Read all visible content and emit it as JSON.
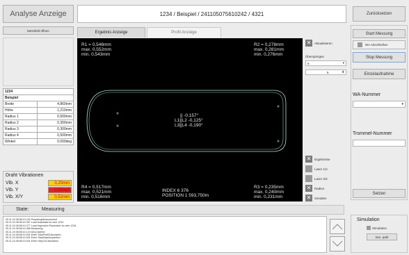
{
  "app": {
    "title": "Analyse Anzeige"
  },
  "header": {
    "path": "1234 / Beispiel / 241105075610242 / 4321",
    "back_label": "Zurücksetzen"
  },
  "left": {
    "open_list_button": "Messfeld öffnen",
    "table": {
      "heading1": "1234",
      "heading2": "Beispiel",
      "rows": [
        {
          "label": "Breite",
          "value": "4,860mm"
        },
        {
          "label": "Höhe",
          "value": "1,210mm"
        },
        {
          "label": "Radius 1",
          "value": "0,500mm"
        },
        {
          "label": "Radius 2",
          "value": "0,300mm"
        },
        {
          "label": "Radius 3",
          "value": "0,300mm"
        },
        {
          "label": "Radius 4",
          "value": "0,500mm"
        },
        {
          "label": "Winkel",
          "value": "0,000deg"
        }
      ]
    },
    "vibration": {
      "title": "Draht Vibrationen",
      "rows": [
        {
          "label": "Vib. X",
          "value": "0,20mm",
          "color": "#ffd000"
        },
        {
          "label": "Vib. Y",
          "value": "0,65mm",
          "color": "#e82020"
        },
        {
          "label": "Vib. X/Y",
          "value": "0,52mm",
          "color": "#ffd000"
        }
      ]
    }
  },
  "tabs": [
    {
      "label": "Ergebnis Anzeige"
    },
    {
      "label": "Profil Anzeige"
    }
  ],
  "canvas": {
    "top_left": [
      "R1 = 0,548mm",
      "max. 0,552mm",
      "min. 0,543mm"
    ],
    "top_right": [
      "R2 = 0,278mm",
      "max. 0,281mm",
      "min. 0,276mm"
    ],
    "bottom_left": [
      "R4 = 0,517mm",
      "max. 0,521mm",
      "min. 0,516mm"
    ],
    "bottom_right": [
      "R3 = 0,235mm",
      "max. 0,240mm",
      "min. 0,231mm"
    ],
    "center": [
      "||   -0,157°",
      "L1||L2 -0,125°",
      "L3||L4 -0,190°"
    ],
    "index": "INDEX 6 376",
    "position": "POSITION 1 593,750m"
  },
  "options_top": {
    "aktualisieren": "Aktualisieren",
    "ueberspringen": "Überspringen",
    "select_value": "5",
    "spin_value": "5"
  },
  "options_bottom": [
    {
      "label": "Ergebnisse",
      "checked": true
    },
    {
      "label": "Laser 1/2",
      "checked": false
    },
    {
      "label": "Laser 3/4",
      "checked": false
    },
    {
      "label": "Radien",
      "checked": true
    },
    {
      "label": "Geraden",
      "checked": true
    }
  ],
  "right": {
    "start_button": "Start Messung",
    "wa_abschliessen": "WA Abschließen",
    "stop_button": "Stop Messung",
    "einzel_button": "Einzelaufnahme",
    "wa_title": "WA-Nummer",
    "trommel_title": "Trommel-Nummer",
    "set_button": "Setzen",
    "sim_title": "Simulation",
    "sim_check": "Simulation",
    "sim_path_button": "Sim. path"
  },
  "status": {
    "label": "State:",
    "value": "Measuring"
  },
  "log": [
    "05.11.24 08:56:10.242 PreparingMeasurement",
    "05.11.24 08:56:10.267 Load teachdata for wire 1234",
    "05.11.24 08:56:10.277 Load inspection Parameter for wire 1234",
    "05.11.24 08:56:10.368 Measuring",
    "05.11.24 08:56:10.124 DAQ started",
    "05.11.24 08:56:10.541 Enter StepProfilCalculation",
    "05.11.24 08:56:10.541 Enter StepDataAcquisition",
    "05.11.24 08:56:10.541 Enter StepLSCalculation"
  ]
}
